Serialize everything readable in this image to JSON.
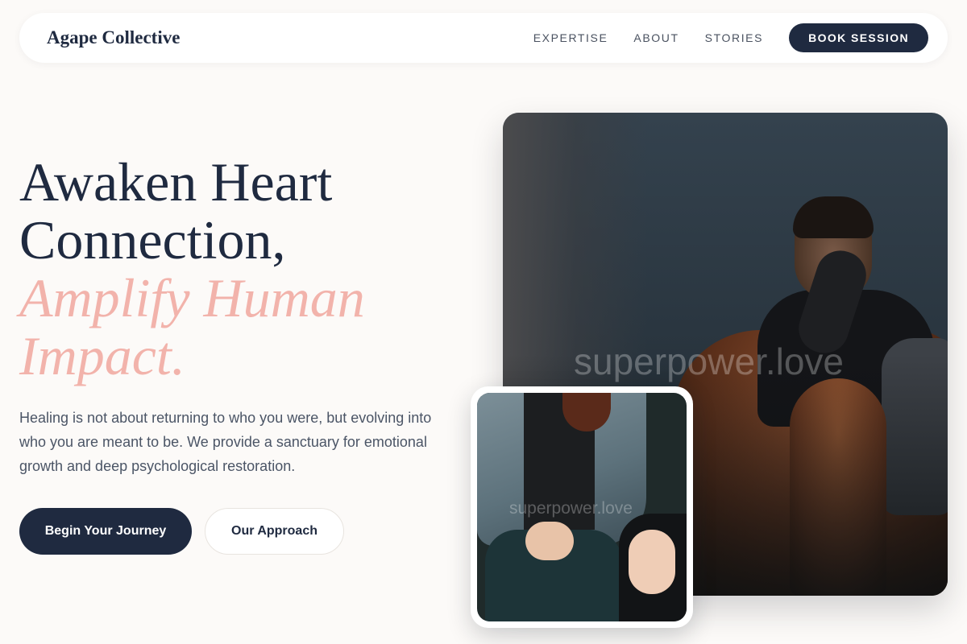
{
  "brand": "Agape Collective",
  "nav": {
    "links": [
      "EXPERTISE",
      "ABOUT",
      "STORIES"
    ],
    "cta": "BOOK SESSION"
  },
  "hero": {
    "title_line1": "Awaken Heart",
    "title_line2": "Connection,",
    "accent_line1": "Amplify Human",
    "accent_line2": "Impact.",
    "description": "Healing is not about returning to who you were, but evolving into who you are meant to be. We provide a sanctuary for emotional growth and deep psychological restoration.",
    "primary_button": "Begin Your Journey",
    "secondary_button": "Our Approach"
  },
  "images": {
    "main_watermark": "superpower.love",
    "inset_watermark": "superpower.love"
  },
  "colors": {
    "navy": "#1f2a40",
    "accent_pink": "#f2b3ab",
    "background": "#fcfaf8"
  }
}
